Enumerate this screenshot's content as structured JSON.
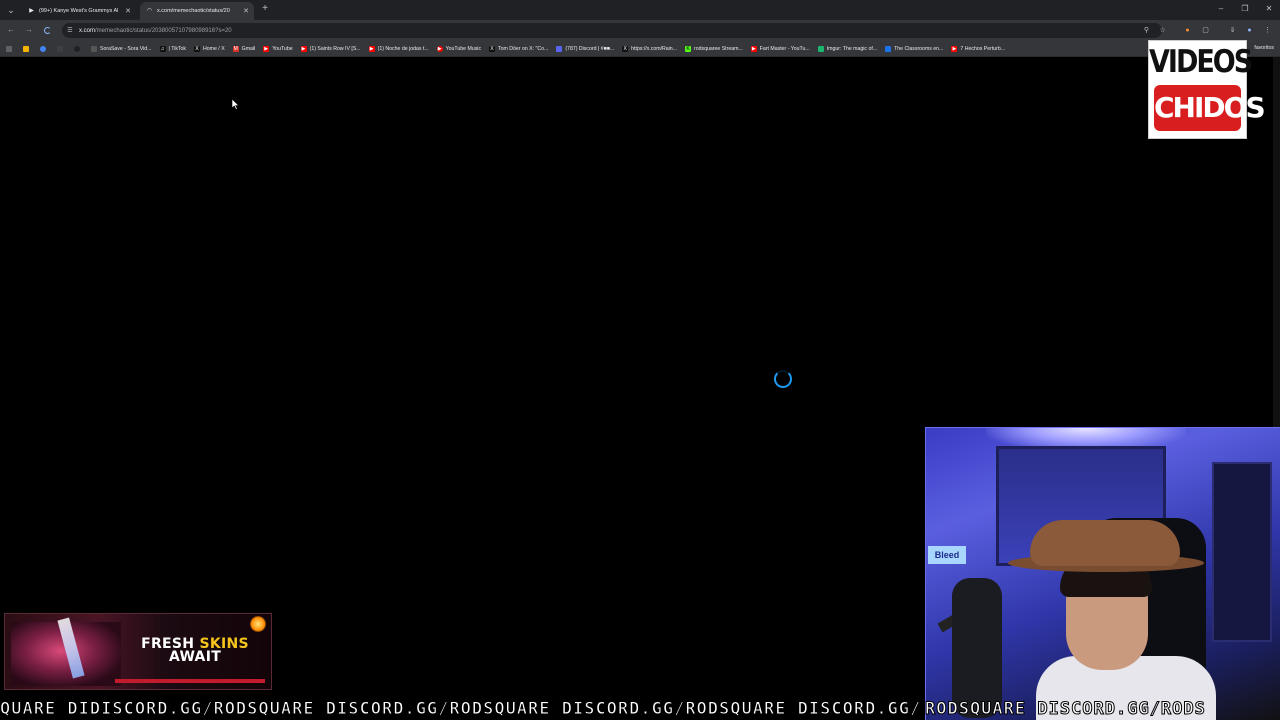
{
  "browser": {
    "tabs": [
      {
        "title": "(99+) Kanye West's Grammys Al",
        "icon": "youtube-icon",
        "active": false
      },
      {
        "title": "x.com/memechaotic/status/20",
        "icon": "x-logo-icon",
        "active": true
      }
    ],
    "address": {
      "host": "x.com",
      "path": "/memechaotic/status/2038005710798098916?s=20"
    },
    "bookmarks": [
      {
        "label": "SoraSave - Sora Vid...",
        "icon_color": "#555"
      },
      {
        "label": "| TikTok",
        "icon_color": "#111"
      },
      {
        "label": "Home / X",
        "icon_color": "#111"
      },
      {
        "label": "Gmail",
        "icon_color": "#d93025"
      },
      {
        "label": "YouTube",
        "icon_color": "#ff0000"
      },
      {
        "label": "(1) Saints Row IV [S...",
        "icon_color": "#ff0000"
      },
      {
        "label": "(1) Noche de jodas t...",
        "icon_color": "#ff0000"
      },
      {
        "label": "YouTube Music",
        "icon_color": "#ff0000"
      },
      {
        "label": "Tom Dōer on X: \"Co...",
        "icon_color": "#111"
      },
      {
        "label": "(787) Discord | #■■...",
        "icon_color": "#5865f2"
      },
      {
        "label": "https://x.com/Rain...",
        "icon_color": "#111"
      },
      {
        "label": "rodsquaree Stream...",
        "icon_color": "#53fc18"
      },
      {
        "label": "Fart Master - YouTu...",
        "icon_color": "#ff0000"
      },
      {
        "label": "Imgur: The magic of...",
        "icon_color": "#1bb76e"
      },
      {
        "label": "The Classrooms en...",
        "icon_color": "#1a73e8"
      },
      {
        "label": "7 Hechos Perturb...",
        "icon_color": "#ff0000"
      }
    ],
    "bookmarks_end": "favoritos"
  },
  "overlays": {
    "logo_line1": "VIDEOS",
    "logo_line2": "CHIDOS",
    "promo_line1_white": "FRESH ",
    "promo_line1_yellow": "SKINS",
    "promo_line2": "AWAIT",
    "webcam_sign": "Bleed",
    "ticker_left": "QUARE DIDISCORD.GG/RODSQUARE DISCORD.GG/RODSQUARE DISCORD.GG/RODSQUARE DISCORD.GG/",
    "ticker_right": "RODSQUARE DISCORD.GG/RODS"
  }
}
